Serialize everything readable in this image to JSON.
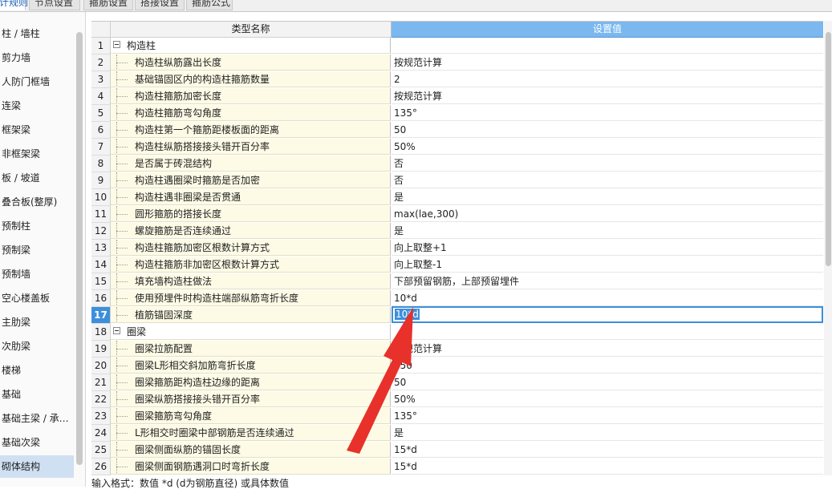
{
  "tabs": [
    "计规则",
    "节点设置",
    "箍筋设置",
    "搭接设置",
    "箍筋公式"
  ],
  "sidebar": {
    "items": [
      "柱 / 墙柱",
      "剪力墙",
      "人防门框墙",
      "连梁",
      "框架梁",
      "非框架梁",
      "板 / 坡道",
      "叠合板(整厚)",
      "预制柱",
      "预制梁",
      "预制墙",
      "空心楼盖板",
      "主肋梁",
      "次肋梁",
      "楼梯",
      "基础",
      "基础主梁 / 承…",
      "基础次梁",
      "砌体结构"
    ],
    "selected_index": 18
  },
  "grid": {
    "col_name": "类型名称",
    "col_value": "设置值",
    "rows": [
      {
        "num": "1",
        "name": "构造柱",
        "value": "",
        "group": true
      },
      {
        "num": "2",
        "name": "构造柱纵筋露出长度",
        "value": "按规范计算"
      },
      {
        "num": "3",
        "name": "基础锚固区内的构造柱箍筋数量",
        "value": "2"
      },
      {
        "num": "4",
        "name": "构造柱箍筋加密长度",
        "value": "按规范计算"
      },
      {
        "num": "5",
        "name": "构造柱箍筋弯勾角度",
        "value": "135°"
      },
      {
        "num": "6",
        "name": "构造柱第一个箍筋距楼板面的距离",
        "value": "50"
      },
      {
        "num": "7",
        "name": "构造柱纵筋搭接接头错开百分率",
        "value": "50%"
      },
      {
        "num": "8",
        "name": "是否属于砖混结构",
        "value": "否"
      },
      {
        "num": "9",
        "name": "构造柱遇圈梁时箍筋是否加密",
        "value": "否"
      },
      {
        "num": "10",
        "name": "构造柱遇非圈梁是否贯通",
        "value": "是"
      },
      {
        "num": "11",
        "name": "圆形箍筋的搭接长度",
        "value": "max(lae,300)"
      },
      {
        "num": "12",
        "name": "螺旋箍筋是否连续通过",
        "value": "是"
      },
      {
        "num": "13",
        "name": "构造柱箍筋加密区根数计算方式",
        "value": "向上取整+1"
      },
      {
        "num": "14",
        "name": "构造柱箍筋非加密区根数计算方式",
        "value": "向上取整-1"
      },
      {
        "num": "15",
        "name": "填充墙构造柱做法",
        "value": "下部预留钢筋，上部预留埋件"
      },
      {
        "num": "16",
        "name": "使用预埋件时构造柱端部纵筋弯折长度",
        "value": "10*d"
      },
      {
        "num": "17",
        "name": "植筋锚固深度",
        "value": "10*d",
        "editing": true
      },
      {
        "num": "18",
        "name": "圈梁",
        "value": "",
        "group": true
      },
      {
        "num": "19",
        "name": "圈梁拉筋配置",
        "value": "按规范计算"
      },
      {
        "num": "20",
        "name": "圈梁L形相交斜加筋弯折长度",
        "value": "250"
      },
      {
        "num": "21",
        "name": "圈梁箍筋距构造柱边缘的距离",
        "value": "50"
      },
      {
        "num": "22",
        "name": "圈梁纵筋搭接接头错开百分率",
        "value": "50%"
      },
      {
        "num": "23",
        "name": "圈梁箍筋弯勾角度",
        "value": "135°"
      },
      {
        "num": "24",
        "name": "L形相交时圈梁中部钢筋是否连续通过",
        "value": "是"
      },
      {
        "num": "25",
        "name": "圈梁侧面纵筋的锚固长度",
        "value": "15*d"
      },
      {
        "num": "26",
        "name": "圈梁侧面钢筋遇洞口时弯折长度",
        "value": "15*d"
      }
    ]
  },
  "footer_text": "输入格式：数值 *d (d为钢筋直径) 或具体数值",
  "colors": {
    "header_value": "#7ab8ef",
    "selection": "#3d8fdb",
    "name_cell": "#fdfbe6",
    "arrow": "#e8312a"
  }
}
